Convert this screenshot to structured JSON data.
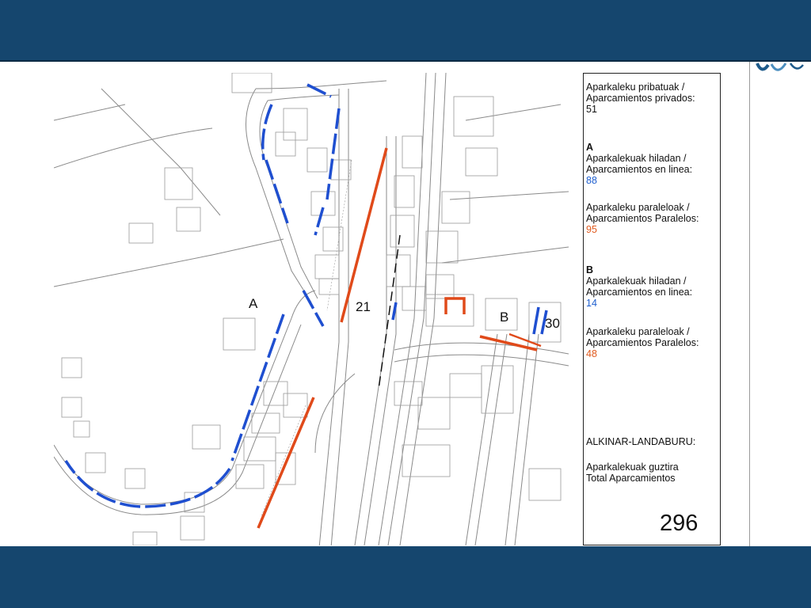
{
  "map": {
    "labels": {
      "zone_a": "A",
      "zone_a_count": "21",
      "zone_b": "B",
      "zone_b_count": "30"
    },
    "colors": {
      "line_parking": "#1f4fd0",
      "parallel_parking": "#e04a1a",
      "base_lines": "#8a8a8a"
    }
  },
  "legend": {
    "private_title_eu": "Aparkaleku pribatuak /",
    "private_title_es": "Aparcamientos privados:",
    "private_value": "51",
    "section_a": "A",
    "a_line_eu": "Aparkalekuak hiladan /",
    "a_line_es": "Aparcamientos en linea:",
    "a_line_value": "88",
    "a_parallel_eu": "Aparkaleku paraleloak /",
    "a_parallel_es": "Aparcamientos Paralelos:",
    "a_parallel_value": "95",
    "section_b": "B",
    "b_line_eu": "Aparkalekuak hiladan /",
    "b_line_es": "Aparcamientos en linea:",
    "b_line_value": "14",
    "b_parallel_eu": "Aparkaleku paraleloak /",
    "b_parallel_es": "Aparcamientos Paralelos:",
    "b_parallel_value": "48",
    "area_name": "ALKINAR-LANDABURU:",
    "total_eu": "Aparkalekuak guztira",
    "total_es": "Total Aparcamientos",
    "total_value": "296"
  }
}
